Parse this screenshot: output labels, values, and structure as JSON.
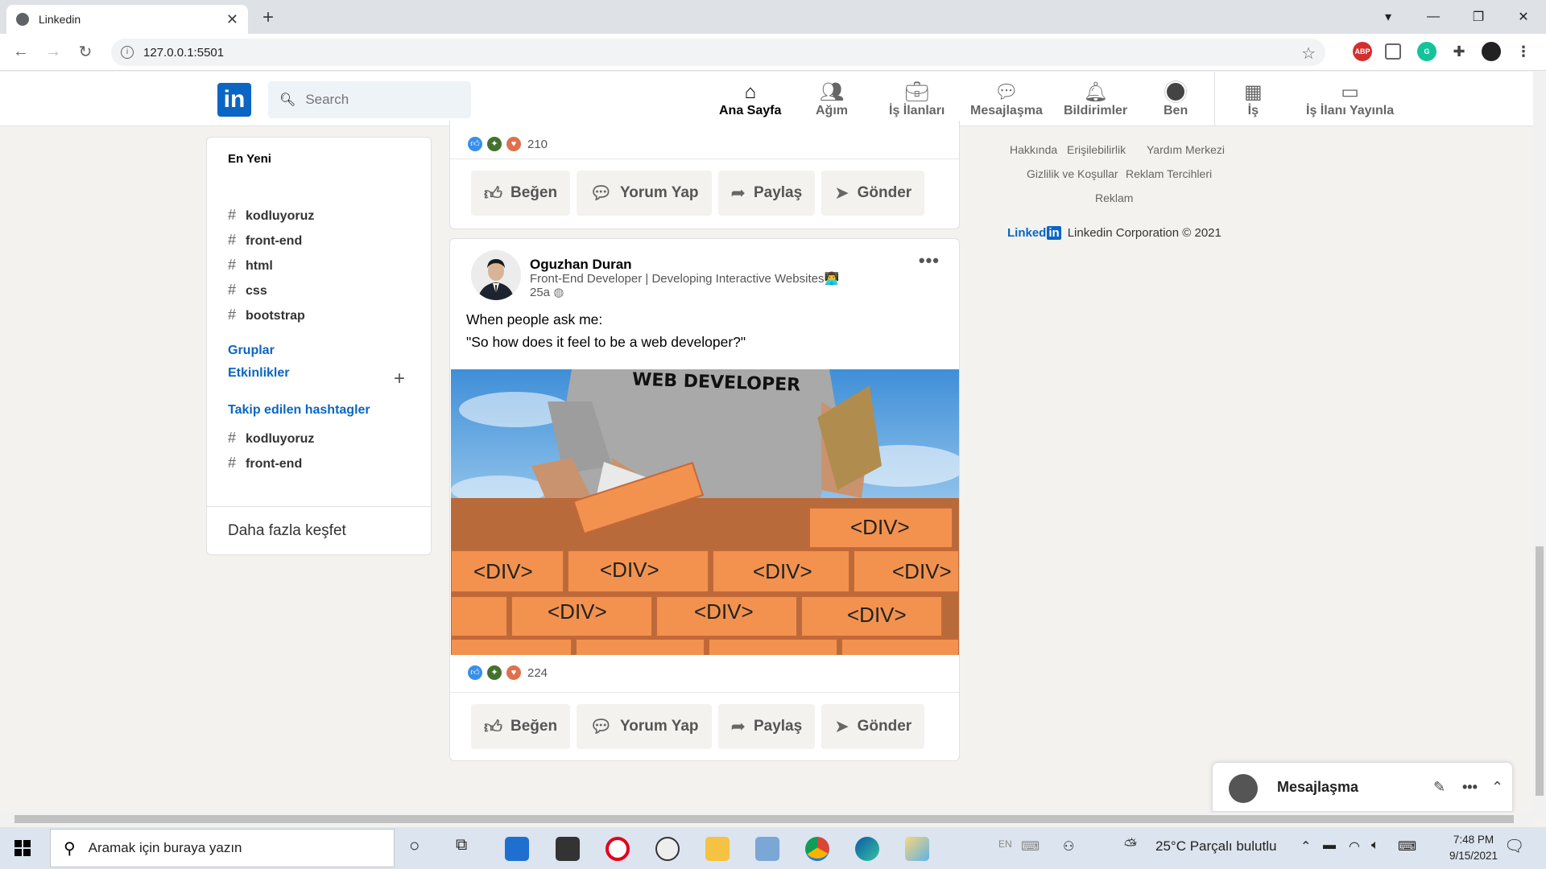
{
  "browser": {
    "tab_title": "Linkedin",
    "url": "127.0.0.1:5501"
  },
  "nav": {
    "logo": "in",
    "search_placeholder": "Search",
    "items": [
      {
        "label": "Ana Sayfa",
        "icon": "home-icon"
      },
      {
        "label": "Ağım",
        "icon": "network-icon"
      },
      {
        "label": "İş İlanları",
        "icon": "briefcase-icon"
      },
      {
        "label": "Mesajlaşma",
        "icon": "chat-icon"
      },
      {
        "label": "Bildirimler",
        "icon": "bell-icon"
      },
      {
        "label": "Ben",
        "icon": "avatar"
      },
      {
        "label": "İş",
        "icon": "grid-icon"
      },
      {
        "label": "İş İlanı Yayınla",
        "icon": "post-job-icon"
      }
    ]
  },
  "sidebar": {
    "heading": "En Yeni",
    "recent_tags": [
      "kodluyoruz",
      "front-end",
      "html",
      "css",
      "bootstrap"
    ],
    "groups": "Gruplar",
    "events": "Etkinlikler",
    "followed_heading": "Takip edilen hashtagler",
    "followed_tags": [
      "kodluyoruz",
      "front-end"
    ],
    "discover": "Daha fazla keşfet"
  },
  "post1": {
    "reaction_count": "210"
  },
  "actions": {
    "like": "Beğen",
    "comment": "Yorum Yap",
    "share": "Paylaş",
    "send": "Gönder"
  },
  "post2": {
    "author": "Oguzhan Duran",
    "headline": "Front-End Developer | Developing Interactive Websites👨‍💻",
    "time": "25a",
    "text_line1": "When people ask me:",
    "text_line2": "\"So how does it feel to be a web developer?\"",
    "image_shirt_text": "WEB DEVELOPER",
    "brick_text": "<DIV>",
    "reaction_count": "224"
  },
  "footer": {
    "links": [
      "Hakkında",
      "Erişilebilirlik",
      "Yardım Merkezi",
      "Gizlilik ve Koşullar",
      "Reklam Tercihleri",
      "Reklam"
    ],
    "copyright": "Linkedin Corporation © 2021",
    "logo_text": "Linked",
    "logo_in": "in"
  },
  "messaging": {
    "title": "Mesajlaşma"
  },
  "taskbar": {
    "search_text": "Aramak için buraya yazın",
    "weather": "25°C  Parçalı bulutlu",
    "lang": "EN",
    "time": "7:48 PM",
    "date": "9/15/2021"
  },
  "colors": {
    "brand": "#0a66c2",
    "background": "#f3f2ef"
  }
}
